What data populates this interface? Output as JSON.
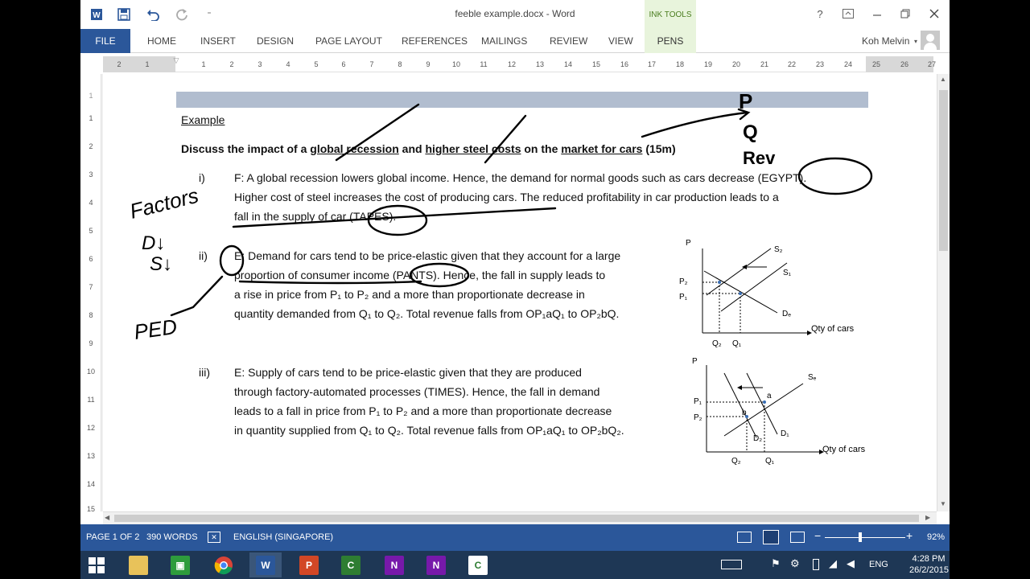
{
  "window": {
    "title": "feeble example.docx - Word"
  },
  "ribbon": {
    "contextual_group": "INK TOOLS",
    "tabs": [
      "FILE",
      "HOME",
      "INSERT",
      "DESIGN",
      "PAGE LAYOUT",
      "REFERENCES",
      "MAILINGS",
      "REVIEW",
      "VIEW",
      "PENS"
    ],
    "user": "Koh Melvin"
  },
  "ruler": {
    "h_ticks": [
      "2",
      "1",
      "",
      "1",
      "2",
      "3",
      "4",
      "5",
      "6",
      "7",
      "8",
      "9",
      "10",
      "11",
      "12",
      "13",
      "14",
      "15",
      "16",
      "17",
      "18",
      "19",
      "20",
      "21",
      "22",
      "23",
      "24",
      "25",
      "26",
      "27"
    ],
    "v_ticks": [
      "1",
      "1",
      "2",
      "3",
      "4",
      "5",
      "6",
      "7",
      "8",
      "9",
      "10",
      "11",
      "12",
      "13",
      "14",
      "15"
    ]
  },
  "document": {
    "heading": "Example",
    "question": {
      "p1": "Discuss the impact of a ",
      "u1": "global recession",
      "p2": " and ",
      "u2": "higher steel costs",
      "p3": " on the ",
      "u3": "market for cars",
      "p4": " (15m)"
    },
    "items": [
      {
        "num": "i)",
        "lines": [
          "F: A global recession lowers global income. Hence, the demand for normal goods such as cars decrease (EGYPT).",
          "Higher cost of steel increases the cost of producing cars. The reduced profitability in car production leads to a",
          "fall in the supply of car (TAPES)."
        ]
      },
      {
        "num": "ii)",
        "lines": [
          "E: Demand for cars tend to be price-elastic given that they account for a large",
          "proportion of consumer income (PANTS). Hence, the fall in supply leads to",
          "a rise in price from P₁ to P₂ and a more than proportionate decrease in",
          "quantity demanded from Q₁ to Q₂. Total revenue falls from OP₁aQ₁ to OP₂bQ."
        ]
      },
      {
        "num": "iii)",
        "lines": [
          "E: Supply of cars tend to be price-elastic given that they are produced",
          "through factory-automated processes (TIMES). Hence, the fall in demand",
          "leads to a fall in price from P₁ to P₂ and a more than proportionate decrease",
          "in quantity supplied from Q₁ to Q₂. Total revenue falls from OP₁aQ₁ to OP₂bQ₂."
        ]
      }
    ],
    "ink": {
      "pqrev": [
        "P",
        "Q",
        "Rev"
      ],
      "factors": "Factors",
      "d_arrow": "D↓",
      "s_arrow": "S↓",
      "ped": "PED"
    },
    "diagram1": {
      "p": "P",
      "s2": "S₂",
      "s1": "S₁",
      "de": "Dₑ",
      "p2": "P₂",
      "p1": "P₁",
      "q2": "Q₂",
      "q1": "Q₁",
      "xlabel": "Qty of cars"
    },
    "diagram2": {
      "p": "P",
      "se": "Sₑ",
      "a": "a",
      "p1": "P₁",
      "p2": "P₂",
      "b": "b",
      "d2": "D₂",
      "d1": "D₁",
      "q2": "Q₂",
      "q1": "Q₁",
      "xlabel": "Qty of cars"
    }
  },
  "statusbar": {
    "page": "PAGE 1 OF 2",
    "words": "390 WORDS",
    "language": "ENGLISH (SINGAPORE)",
    "zoom": "92%"
  },
  "taskbar": {
    "lang": "ENG",
    "time": "4:28 PM",
    "date": "26/2/2015"
  },
  "colors": {
    "word_blue": "#2b579a",
    "ink_green_bg": "#e8f4dc",
    "heading_bar": "#b1bdcf",
    "taskbar": "#1e3755"
  }
}
